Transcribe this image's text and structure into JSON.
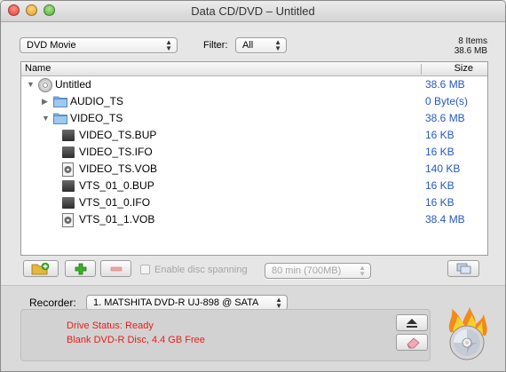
{
  "window": {
    "title": "Data CD/DVD – Untitled"
  },
  "toolbar": {
    "type_select": "DVD Movie",
    "filter_label": "Filter:",
    "filter_select": "All",
    "items_count": "8 Items",
    "total_size": "38.6 MB"
  },
  "list": {
    "columns": {
      "name": "Name",
      "size": "Size"
    },
    "rows": [
      {
        "name": "Untitled",
        "size": "38.6 MB",
        "kind": "disc",
        "level": 0,
        "expanded": true
      },
      {
        "name": "AUDIO_TS",
        "size": "0 Byte(s)",
        "kind": "folder",
        "level": 1,
        "expanded": false
      },
      {
        "name": "VIDEO_TS",
        "size": "38.6 MB",
        "kind": "folder",
        "level": 1,
        "expanded": true
      },
      {
        "name": "VIDEO_TS.BUP",
        "size": "16 KB",
        "kind": "file",
        "level": 2
      },
      {
        "name": "VIDEO_TS.IFO",
        "size": "16 KB",
        "kind": "file",
        "level": 2
      },
      {
        "name": "VIDEO_TS.VOB",
        "size": "140 KB",
        "kind": "vob",
        "level": 2
      },
      {
        "name": "VTS_01_0.BUP",
        "size": "16 KB",
        "kind": "file",
        "level": 2
      },
      {
        "name": "VTS_01_0.IFO",
        "size": "16 KB",
        "kind": "file",
        "level": 2
      },
      {
        "name": "VTS_01_1.VOB",
        "size": "38.4 MB",
        "kind": "vob",
        "level": 2
      }
    ]
  },
  "actions": {
    "spanning_label": "Enable disc spanning",
    "spanning_select": "80 min (700MB)"
  },
  "recorder": {
    "label": "Recorder:",
    "device": "1. MATSHITA DVD-R   UJ-898 @ SATA",
    "status_line1": "Drive Status: Ready",
    "status_line2": "Blank DVD-R Disc, 4.4 GB Free"
  },
  "colors": {
    "accent": "#2459c7",
    "status": "#e5201d"
  }
}
